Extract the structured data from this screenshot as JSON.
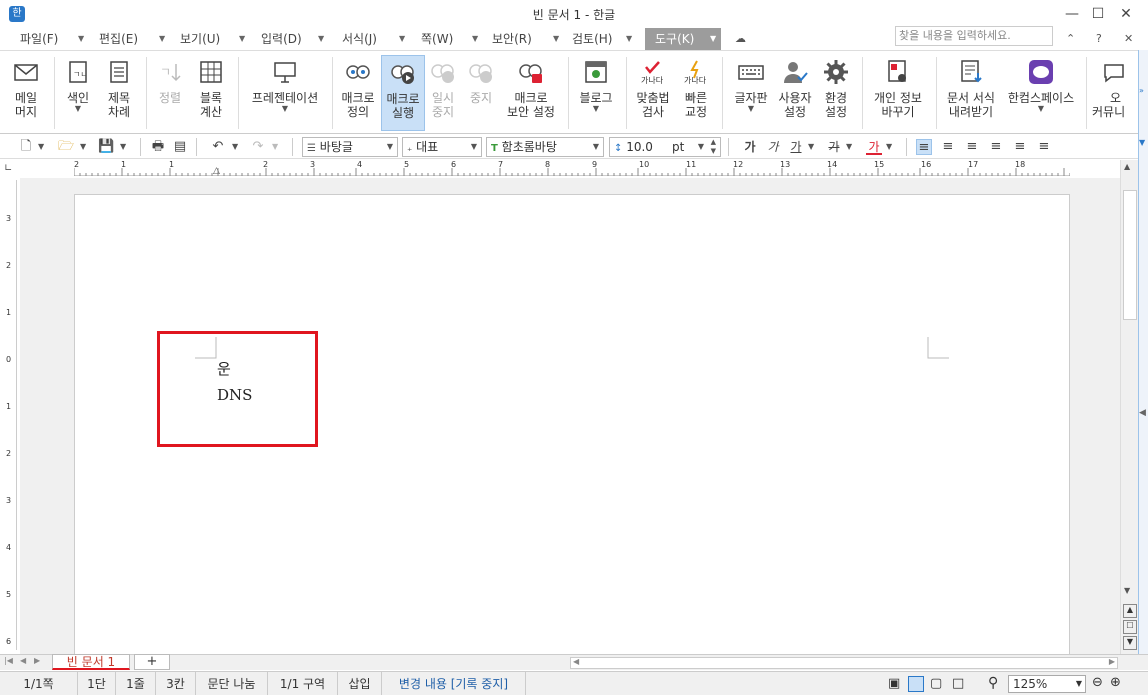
{
  "window": {
    "title": "빈 문서 1 - 한글",
    "app_icon": "한"
  },
  "menu": {
    "items": [
      "파일(F)",
      "편집(E)",
      "보기(U)",
      "입력(D)",
      "서식(J)",
      "쪽(W)",
      "보안(R)",
      "검토(H)",
      "도구(K)"
    ],
    "search_placeholder": "찾을 내용을 입력하세요."
  },
  "ribbon": {
    "buttons": [
      {
        "label": "메일",
        "label2": "머지",
        "icon": "mail-icon"
      },
      {
        "label": "색인",
        "label2": "",
        "icon": "index-icon"
      },
      {
        "label": "제목",
        "label2": "차례",
        "icon": "toc-icon"
      },
      {
        "label": "정렬",
        "label2": "",
        "icon": "sort-icon"
      },
      {
        "label": "블록",
        "label2": "계산",
        "icon": "block-calc-icon"
      },
      {
        "label": "프레젠테이션",
        "label2": "",
        "icon": "presentation-icon"
      },
      {
        "label": "매크로",
        "label2": "정의",
        "icon": "macro-define-icon"
      },
      {
        "label": "매크로",
        "label2": "실행",
        "icon": "macro-run-icon"
      },
      {
        "label": "일시",
        "label2": "중지",
        "icon": "pause-icon"
      },
      {
        "label": "중지",
        "label2": "",
        "icon": "stop-icon"
      },
      {
        "label": "매크로",
        "label2": "보안 설정",
        "icon": "macro-security-icon"
      },
      {
        "label": "블로그",
        "label2": "",
        "icon": "blog-icon"
      },
      {
        "label": "맞춤법",
        "label2": "검사",
        "icon": "spellcheck-icon"
      },
      {
        "label": "빠른",
        "label2": "교정",
        "icon": "quick-correct-icon"
      },
      {
        "label": "글자판",
        "label2": "",
        "icon": "keyboard-icon"
      },
      {
        "label": "사용자",
        "label2": "설정",
        "icon": "user-settings-icon"
      },
      {
        "label": "환경",
        "label2": "설정",
        "icon": "gear-icon"
      },
      {
        "label": "개인 정보",
        "label2": "바꾸기",
        "icon": "privacy-icon"
      },
      {
        "label": "문서 서식",
        "label2": "내려받기",
        "icon": "download-template-icon"
      },
      {
        "label": "한컴스페이스",
        "label2": "",
        "icon": "hancom-space-icon"
      },
      {
        "label": "오",
        "label2": "커뮤니",
        "icon": "community-icon"
      }
    ]
  },
  "toolbar2": {
    "style": "바탕글",
    "language": "대표",
    "font": "함초롬바탕",
    "size": "10.0",
    "size_unit": "pt",
    "format_glyphs": [
      "가",
      "가",
      "가",
      "가",
      "가"
    ]
  },
  "ruler": {
    "h_numbers": [
      "2",
      "1",
      "1",
      "2",
      "3",
      "4",
      "5",
      "6",
      "7",
      "8",
      "9",
      "10",
      "11",
      "12",
      "13",
      "14",
      "15",
      "16",
      "17",
      "18"
    ],
    "v_numbers": [
      "3",
      "2",
      "1",
      "0",
      "1",
      "2",
      "3",
      "4",
      "5",
      "6"
    ]
  },
  "document": {
    "line1": "운",
    "line2": "DNS"
  },
  "tabs": {
    "doc_tab": "빈 문서 1",
    "add": "+"
  },
  "status": {
    "page": "1/1쪽",
    "column": "1단",
    "line": "1줄",
    "col": "3칸",
    "para_split": "문단 나눔",
    "section": "1/1 구역",
    "mode": "삽입",
    "track": "변경 내용 [기록 중지]",
    "zoom": "125%"
  }
}
